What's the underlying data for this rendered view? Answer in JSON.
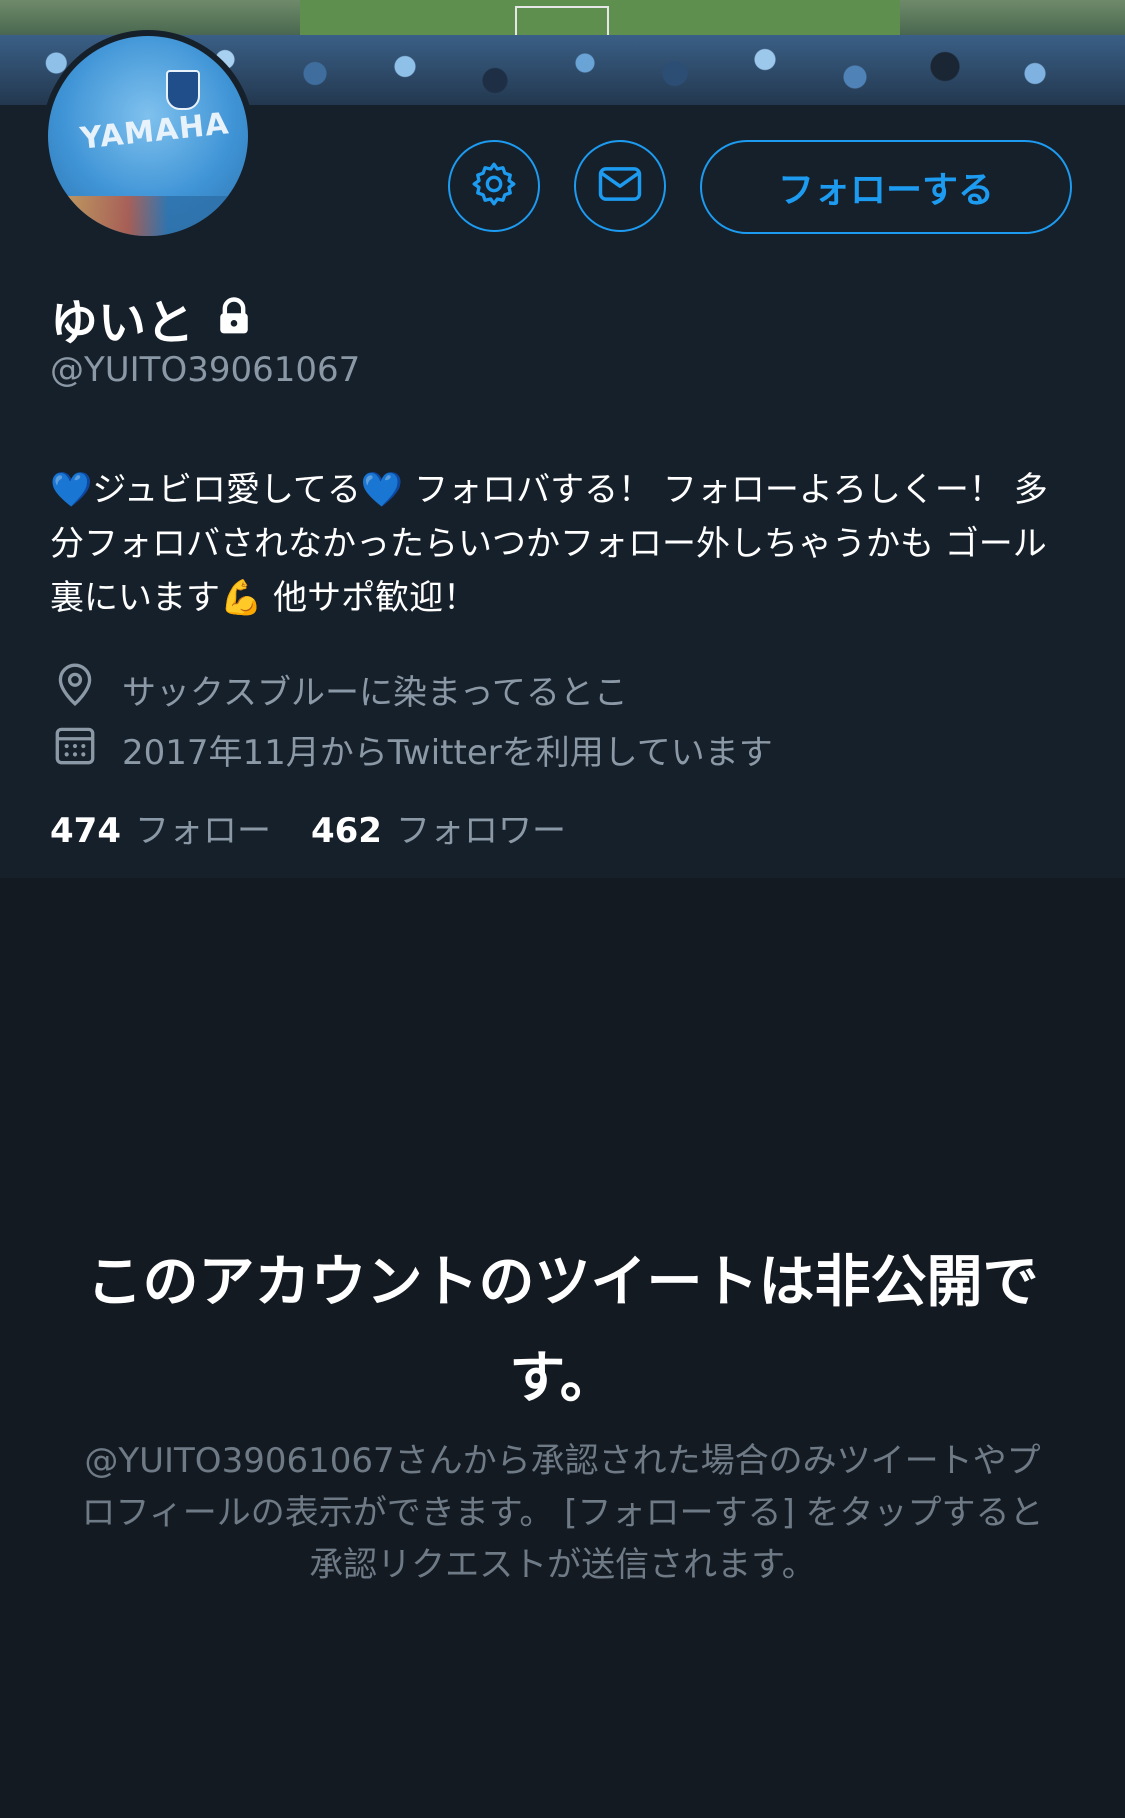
{
  "profile": {
    "name": "ゆいと",
    "handle": "@YUITO39061067",
    "avatar_text": "YAMAHA",
    "bio": "💙ジュビロ愛してる💙 フォロバする！ フォローよろしくー！ 多分フォロバされなかったらいつかフォロー外しちゃうかも ゴール裏にいます💪 他サポ歓迎！",
    "location": "サックスブルーに染まってるとこ",
    "joined": "2017年11月からTwitterを利用しています",
    "following_count": "474",
    "following_label": "フォロー",
    "followers_count": "462",
    "followers_label": "フォロワー"
  },
  "actions": {
    "follow_label": "フォローする"
  },
  "private_notice": {
    "title": "このアカウントのツイートは非公開です。",
    "body": "@YUITO39061067さんから承認された場合のみツイートやプロフィールの表示ができます。 [フォローする] をタップすると承認リクエストが送信されます。"
  },
  "colors": {
    "accent": "#1d9bf0",
    "background": "#141a22",
    "panel": "#16202b",
    "secondary_text": "#8b98a5"
  },
  "icons": [
    "gear-icon",
    "mail-icon",
    "lock-icon",
    "location-icon",
    "calendar-icon"
  ]
}
